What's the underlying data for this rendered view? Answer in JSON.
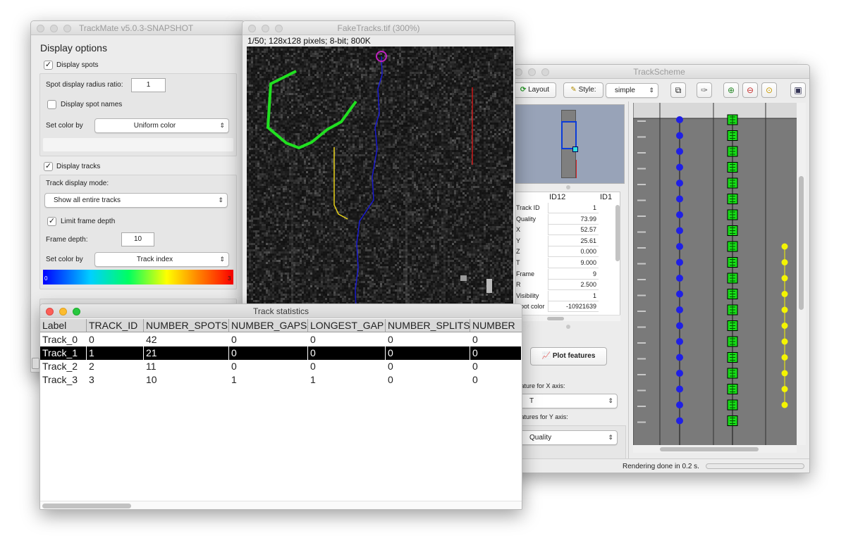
{
  "trackmate": {
    "title": "TrackMate v5.0.3-SNAPSHOT",
    "heading": "Display options",
    "display_spots": "Display spots",
    "spot_radius_label": "Spot display radius ratio:",
    "spot_radius_value": "1",
    "display_spot_names": "Display spot names",
    "set_color_by_label": "Set color by",
    "spot_color_mode": "Uniform color",
    "display_tracks": "Display tracks",
    "track_display_mode_label": "Track display mode:",
    "track_display_mode": "Show all entire tracks",
    "limit_frame_depth": "Limit frame depth",
    "frame_depth_label": "Frame depth:",
    "frame_depth_value": "10",
    "set_color_by_label2": "Set color by",
    "track_color_mode": "Track index",
    "colorbar_min": "0",
    "colorbar_max": "3"
  },
  "image": {
    "title": "FakeTracks.tif (300%)",
    "info": "1/50; 128x128 pixels; 8-bit; 800K"
  },
  "stats": {
    "title": "Track statistics",
    "columns": [
      "Label",
      "TRACK_ID",
      "NUMBER_SPOTS",
      "NUMBER_GAPS",
      "LONGEST_GAP",
      "NUMBER_SPLITS",
      "NUMBER"
    ],
    "rows": [
      [
        "Track_0",
        "0",
        "42",
        "0",
        "0",
        "0",
        "0"
      ],
      [
        "Track_1",
        "1",
        "21",
        "0",
        "0",
        "0",
        "0"
      ],
      [
        "Track_2",
        "2",
        "11",
        "0",
        "0",
        "0",
        "0"
      ],
      [
        "Track_3",
        "3",
        "10",
        "1",
        "1",
        "0",
        "0"
      ]
    ]
  },
  "trackscheme": {
    "title": "TrackScheme",
    "layout_label": "Layout",
    "style_label": "Style:",
    "style_value": "simple",
    "col_id": "ID12",
    "col_id2": "ID1",
    "features": [
      {
        "name": "Track ID",
        "value": "1"
      },
      {
        "name": "Quality",
        "value": "73.99"
      },
      {
        "name": "X",
        "value": "52.57"
      },
      {
        "name": "Y",
        "value": "25.61"
      },
      {
        "name": "Z",
        "value": "0.000"
      },
      {
        "name": "T",
        "value": "9.000"
      },
      {
        "name": "Frame",
        "value": "9"
      },
      {
        "name": "R",
        "value": "2.500"
      },
      {
        "name": "Visibility",
        "value": "1"
      },
      {
        "name": "Spot color",
        "value": "-10921639"
      }
    ],
    "plot_features": "Plot features",
    "x_axis_label": "Feature for X axis:",
    "x_axis_value": "T",
    "y_axis_label": "Features for Y axis:",
    "y_axis_value": "Quality",
    "status": "Rendering done in 0.2 s.",
    "colors": {
      "blue": "#1f1fe6",
      "green": "#18e018",
      "yellow": "#f4f400"
    }
  },
  "colors": {
    "track0": "#1a1ad0",
    "track1": "#21e021",
    "track2": "#e8d21a",
    "track3": "#c81818"
  }
}
